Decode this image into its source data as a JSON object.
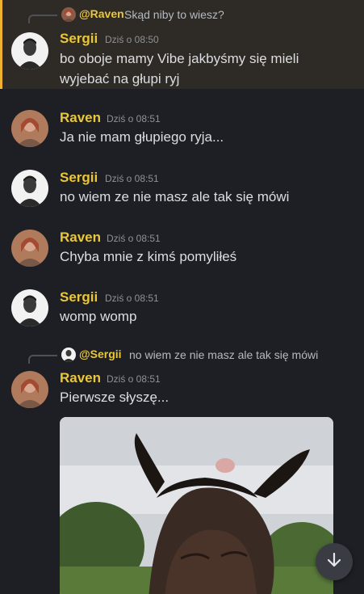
{
  "messages": [
    {
      "author": "Sergii",
      "time": "Dziś o 08:50",
      "lines": [
        "bo oboje mamy Vibe jakbyśmy się mieli",
        "wyjebać na głupi ryj"
      ],
      "reply": {
        "author": "@Raven",
        "text": "Skąd niby to wiesz?"
      },
      "avatar": "sergii-avatar"
    },
    {
      "author": "Raven",
      "time": "Dziś o 08:51",
      "lines": [
        "Ja nie mam głupiego ryja..."
      ],
      "avatar": "raven-avatar"
    },
    {
      "author": "Sergii",
      "time": "Dziś o 08:51",
      "lines": [
        "no wiem ze nie masz ale tak się mówi"
      ],
      "avatar": "sergii-avatar"
    },
    {
      "author": "Raven",
      "time": "Dziś o 08:51",
      "lines": [
        "Chyba mnie z kimś pomyliłeś"
      ],
      "avatar": "raven-avatar"
    },
    {
      "author": "Sergii",
      "time": "Dziś o 08:51",
      "lines": [
        "womp womp"
      ],
      "avatar": "sergii-avatar"
    },
    {
      "author": "Raven",
      "time": "Dziś o 08:51",
      "lines": [
        "Pierwsze słyszę..."
      ],
      "reply": {
        "author": "@Sergii",
        "text": "no wiem ze nie masz ale tak się mówi"
      },
      "avatar": "raven-avatar",
      "attachment": "video-thumbnail"
    }
  ],
  "icons": {
    "scroll": "arrow-down-icon"
  },
  "colors": {
    "background": "#1e1f24",
    "username": "#e9c73d",
    "mention_bar": "#f0b232",
    "timestamp": "#8e9297"
  }
}
